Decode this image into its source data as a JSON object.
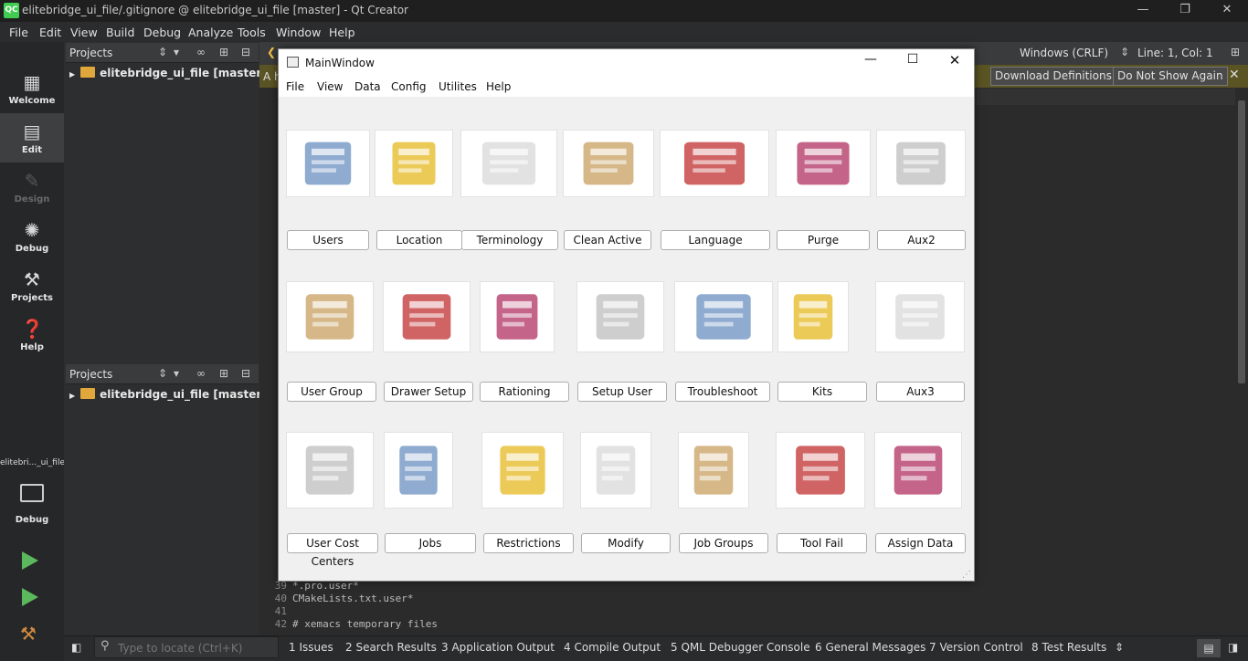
{
  "app": {
    "window_title": "elitebridge_ui_file/.gitignore @ elitebridge_ui_file [master] - Qt Creator",
    "menu": [
      "File",
      "Edit",
      "View",
      "Build",
      "Debug",
      "Analyze",
      "Tools",
      "Window",
      "Help"
    ]
  },
  "modes": [
    {
      "label": "Welcome"
    },
    {
      "label": "Edit"
    },
    {
      "label": "Design"
    },
    {
      "label": "Debug"
    },
    {
      "label": "Projects"
    },
    {
      "label": "Help"
    }
  ],
  "kit": {
    "target": "elitebri..._ui_file",
    "label": "Debug"
  },
  "projects": {
    "header": "Projects",
    "item": "elitebridge_ui_file [master]"
  },
  "editor": {
    "tab_prefix": "A h",
    "line_endings": "Windows (CRLF)",
    "position": "Line: 1, Col: 1",
    "download_definitions": "Download Definitions",
    "do_not_show_again": "Do Not Show Again",
    "lines": [
      {
        "n": "39",
        "text": "*.pro.user*"
      },
      {
        "n": "40",
        "text": "CMakeLists.txt.user*"
      },
      {
        "n": "41",
        "text": ""
      },
      {
        "n": "42",
        "text": "# xemacs temporary files"
      }
    ]
  },
  "locator": {
    "placeholder": "Type to locate (Ctrl+K)"
  },
  "output_tabs": [
    "1  Issues",
    "2  Search Results",
    "3  Application Output",
    "4  Compile Output",
    "5  QML Debugger Console",
    "6  General Messages",
    "7  Version Control",
    "8  Test Results"
  ],
  "main_window": {
    "title": "MainWindow",
    "menu": [
      "File",
      "View",
      "Data",
      "Config",
      "Utilites",
      "Help"
    ],
    "rows": [
      [
        "Users",
        "Location",
        "Terminology",
        "Clean Active",
        "Language",
        "Purge",
        "Aux2"
      ],
      [
        "User Group",
        "Drawer Setup",
        "Rationing",
        "Setup User",
        "Troubleshoot",
        "Kits",
        "Aux3"
      ],
      [
        "User Cost Centers",
        "Jobs",
        "Restrictions",
        "Modify",
        "Job Groups",
        "Tool Fail",
        "Assign Data"
      ]
    ],
    "icons": [
      [
        "users-icon",
        "location-cabinet-icon",
        "terminology-icon",
        "clean-active-icon",
        "language-flags-icon",
        "purge-basket-icon",
        "aux2-documents-icon"
      ],
      [
        "user-group-icon",
        "drawer-setup-icon",
        "rationing-icon",
        "setup-user-icon",
        "troubleshoot-stethoscope-icon",
        "kits-icon",
        "aux3-documents-icon"
      ],
      [
        "user-cost-centers-icon",
        "jobs-documents-icon",
        "restrictions-icon",
        "modify-icon",
        "job-groups-icon",
        "tool-fail-icon",
        "assign-data-icon"
      ]
    ]
  }
}
